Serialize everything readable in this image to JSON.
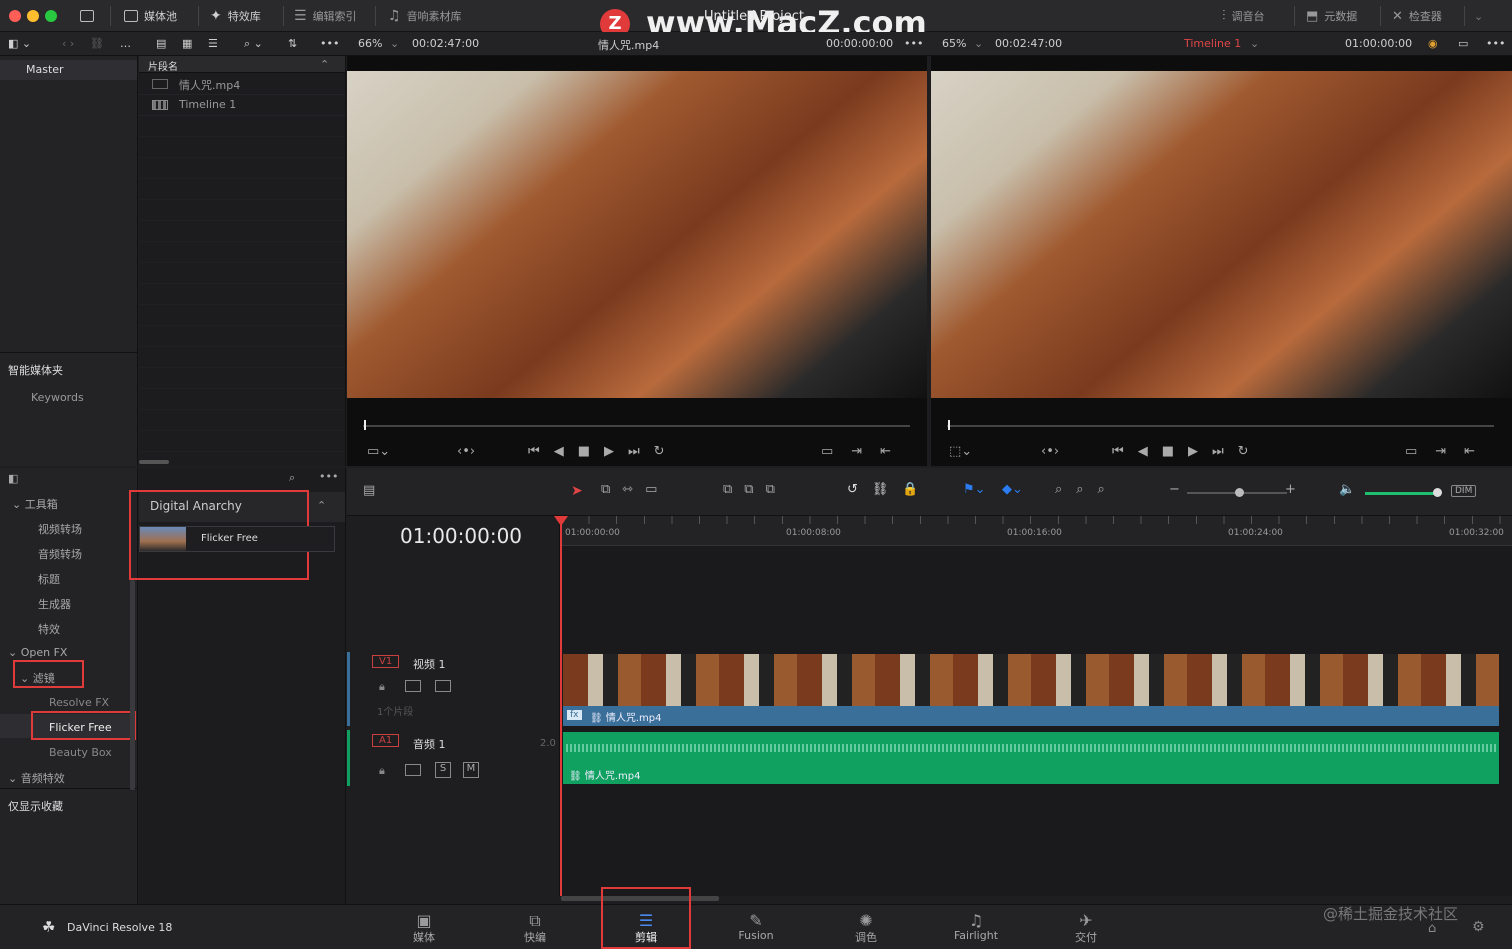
{
  "window": {
    "project_title": "Untitled Project",
    "watermark": "www.MacZ.com",
    "watermark_badge": "Z"
  },
  "top_toolbar": {
    "media_pool": "媒体池",
    "effects_library": "特效库",
    "edit_index": "编辑索引",
    "sound_library": "音响素材库",
    "mixer": "调音台",
    "metadata": "元数据",
    "inspector": "检查器"
  },
  "source_viewer": {
    "zoom": "66%",
    "duration": "00:02:47:00",
    "clip_name": "情人咒.mp4",
    "timecode": "00:00:00:00"
  },
  "timeline_viewer": {
    "zoom": "65%",
    "duration": "00:02:47:00",
    "timeline_name": "Timeline 1",
    "timecode": "01:00:00:00"
  },
  "bins": {
    "master": "Master",
    "smart_bins_header": "智能媒体夹",
    "keywords": "Keywords"
  },
  "media_pool": {
    "column_header": "片段名",
    "items": [
      "情人咒.mp4",
      "Timeline 1"
    ]
  },
  "effects_tree": {
    "toolbox": "工具箱",
    "video_transitions": "视频转场",
    "audio_transitions": "音频转场",
    "titles": "标题",
    "generators": "生成器",
    "effects": "特效",
    "open_fx": "Open FX",
    "filters": "滤镜",
    "resolve_fx": "Resolve FX",
    "flicker_free": "Flicker Free",
    "beauty_box": "Beauty Box",
    "audio_fx": "音频特效",
    "favorites_only": "仅显示收藏"
  },
  "effects_panel": {
    "group_title": "Digital Anarchy",
    "effect_item": "Flicker Free"
  },
  "timeline": {
    "current_tc": "01:00:00:00",
    "ruler_marks": [
      "01:00:00:00",
      "01:00:08:00",
      "01:00:16:00",
      "01:00:24:00",
      "01:00:32:00"
    ],
    "dim_label": "DIM",
    "v1": {
      "id": "V1",
      "name": "视频 1",
      "clip_count": "1个片段",
      "clip_name": "情人咒.mp4",
      "fx_badge": "fx"
    },
    "a1": {
      "id": "A1",
      "name": "音频 1",
      "level": "2.0",
      "solo": "S",
      "mute": "M",
      "clip_name": "情人咒.mp4"
    }
  },
  "bottom_nav": {
    "app_name": "DaVinci Resolve 18",
    "pages": [
      "媒体",
      "快编",
      "剪辑",
      "Fusion",
      "调色",
      "Fairlight",
      "交付"
    ],
    "watermark": "@稀土掘金技术社区"
  },
  "colors": {
    "accent_red": "#e03a3a",
    "video_clip": "#3a6f99",
    "audio_clip": "#10a060",
    "playhead": "#e03a3a"
  }
}
